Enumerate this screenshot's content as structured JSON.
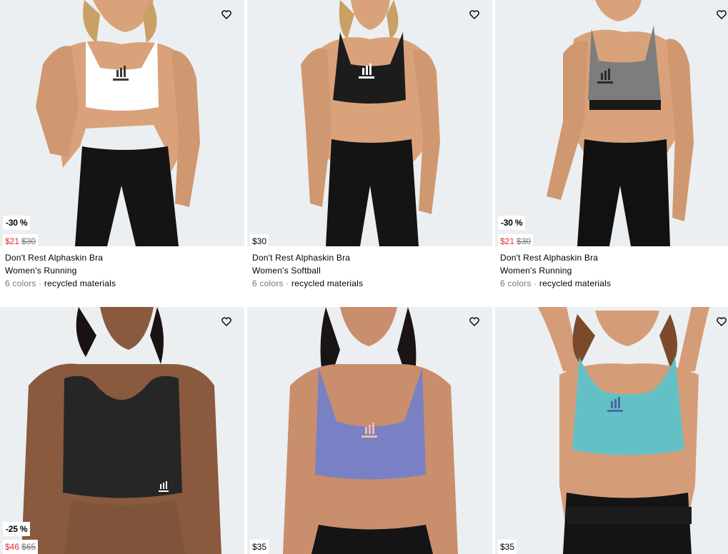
{
  "products": [
    {
      "badge": "-30 %",
      "sale_price": "$21",
      "original_price": "$30",
      "name": "Don't Rest Alphaskin Bra",
      "category": "Women's Running",
      "colors": "6 colors",
      "tag": "recycled materials",
      "bra_color": "#ffffff",
      "logo_color": "#3a3a3a",
      "wishlist_icon": "heart-outline-icon"
    },
    {
      "badge": "",
      "price": "$30",
      "name": "Don't Rest Alphaskin Bra",
      "category": "Women's Softball",
      "colors": "6 colors",
      "tag": "recycled materials",
      "bra_color": "#1c1c1c",
      "logo_color": "#ffffff",
      "wishlist_icon": "heart-outline-icon"
    },
    {
      "badge": "-30 %",
      "sale_price": "$21",
      "original_price": "$30",
      "name": "Don't Rest Alphaskin Bra",
      "category": "Women's Running",
      "colors": "6 colors",
      "tag": "recycled materials",
      "bra_color": "#7d7d7d",
      "logo_color": "#2a2a2a",
      "wishlist_icon": "heart-outline-icon"
    },
    {
      "badge": "-25 %",
      "sale_price": "$46",
      "original_price": "$65",
      "bra_color": "#262626",
      "logo_color": "#ffffff",
      "wishlist_icon": "heart-outline-icon"
    },
    {
      "badge": "",
      "price": "$35",
      "bra_color": "#7a80c4",
      "logo_color": "#f4b9a8",
      "wishlist_icon": "heart-outline-icon"
    },
    {
      "badge": "",
      "price": "$35",
      "bra_color": "#63c1c6",
      "logo_color": "#4a6aa0",
      "wishlist_icon": "heart-outline-icon"
    }
  ],
  "separator": "·",
  "colors": {
    "sale": "#e32b2b",
    "muted": "#767677",
    "image_bg": "#eceff1"
  }
}
